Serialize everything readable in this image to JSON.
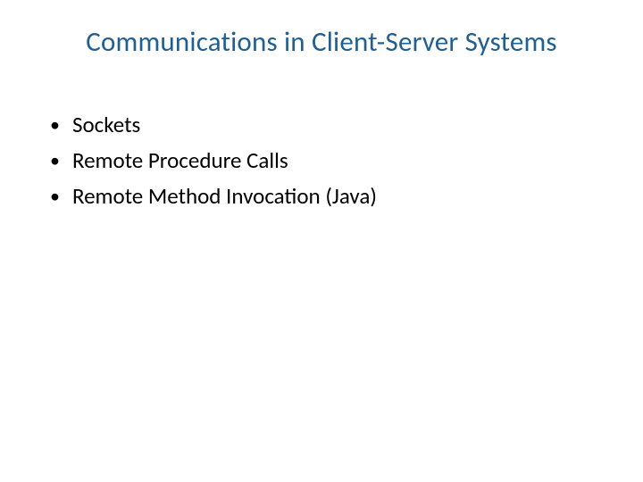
{
  "slide": {
    "title": "Communications in Client-Server Systems",
    "bullets": [
      "Sockets",
      "Remote Procedure Calls",
      "Remote Method Invocation (Java)"
    ]
  }
}
